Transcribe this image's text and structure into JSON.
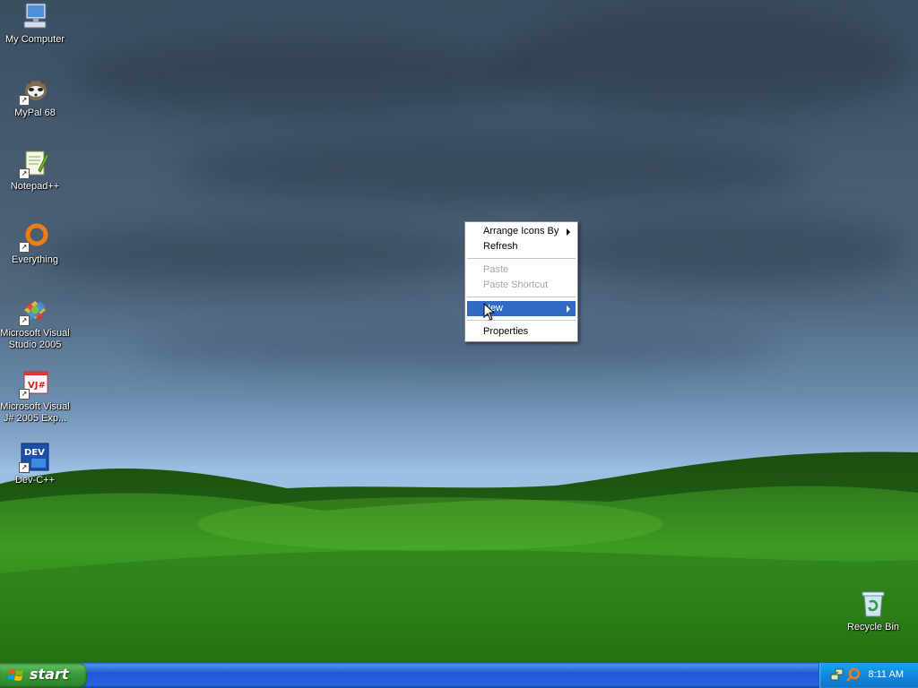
{
  "desktop_icons": [
    {
      "label": "My Computer",
      "icon": "my-computer-icon"
    },
    {
      "label": "MyPal 68",
      "icon": "mypal-icon"
    },
    {
      "label": "Notepad++",
      "icon": "notepadpp-icon"
    },
    {
      "label": "Everything",
      "icon": "everything-icon"
    },
    {
      "label": "Microsoft Visual Studio 2005",
      "icon": "visual-studio-icon"
    },
    {
      "label": "Microsoft Visual J# 2005 Exp...",
      "icon": "visual-jsharp-icon"
    },
    {
      "label": "Dev-C++",
      "icon": "devcpp-icon"
    },
    {
      "label": "Recycle Bin",
      "icon": "recycle-bin-icon"
    }
  ],
  "icon_texts": {
    "vj": "VJ#",
    "dev": "DEV"
  },
  "context_menu": {
    "items": [
      {
        "label": "Arrange Icons By",
        "submenu": true,
        "enabled": true
      },
      {
        "label": "Refresh",
        "submenu": false,
        "enabled": true
      },
      {
        "label": "Paste",
        "submenu": false,
        "enabled": false
      },
      {
        "label": "Paste Shortcut",
        "submenu": false,
        "enabled": false
      },
      {
        "label": "New",
        "submenu": true,
        "enabled": true,
        "highlighted": true
      },
      {
        "label": "Properties",
        "submenu": false,
        "enabled": true
      }
    ]
  },
  "taskbar": {
    "start_label": "start",
    "clock": "8:11 AM"
  },
  "colors": {
    "menu_highlight": "#316ac5",
    "taskbar_blue": "#245edb",
    "start_green": "#3a9a3a",
    "tray_blue": "#1287dc"
  }
}
